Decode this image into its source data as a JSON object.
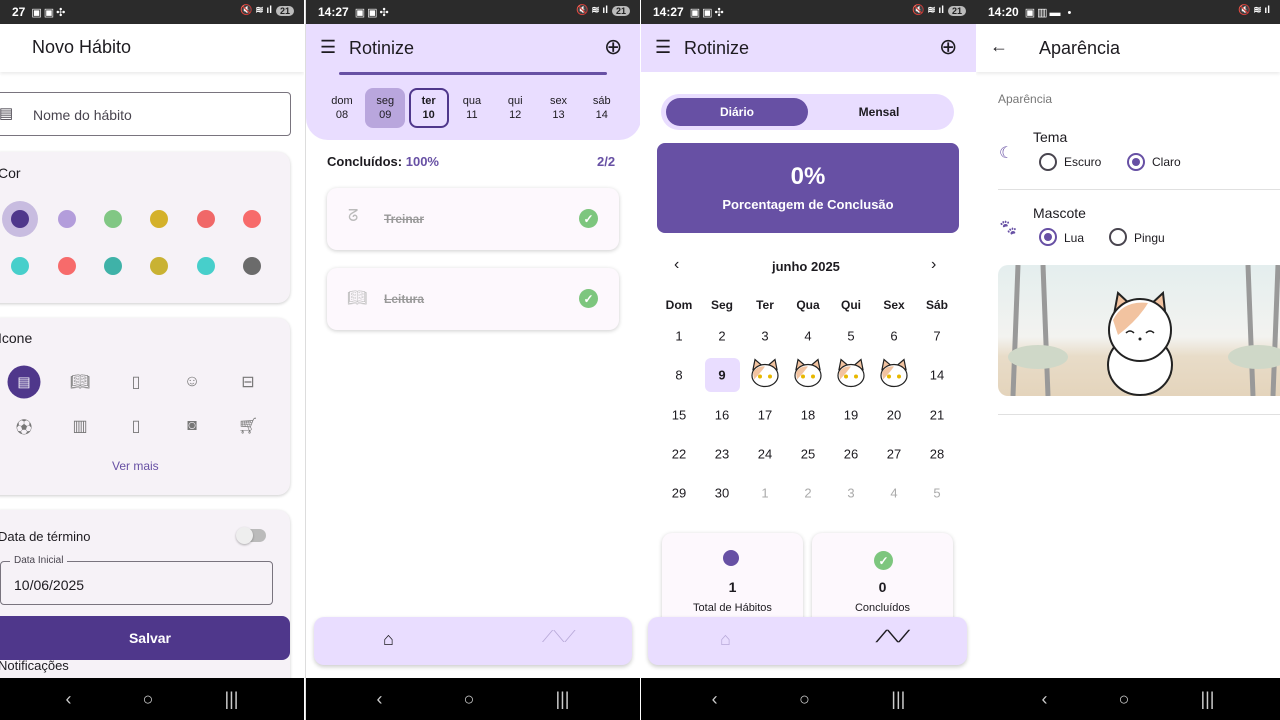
{
  "status": {
    "p1_time": "27",
    "p2_time": "14:27",
    "p3_time": "14:27",
    "p4_time": "14:20",
    "battery": "21"
  },
  "p1": {
    "title": "Novo Hábito",
    "name_placeholder": "Nome do hábito",
    "color_title": "Cor",
    "colors": [
      "#4f378b",
      "#b39ddb",
      "#81c784",
      "#d4b12a",
      "#f06868",
      "#f76b6b",
      "#47cfcb",
      "#f76b6b",
      "#3fb2a8",
      "#c9b233",
      "#47cfcb",
      "#6b6b6b"
    ],
    "icon_title": "Icone",
    "icons": [
      "form",
      "book",
      "notebook",
      "face",
      "briefcase",
      "soccer",
      "luggage",
      "phone",
      "camera",
      "cart"
    ],
    "more": "Ver mais",
    "end_date_label": "Data de término",
    "start_date_label": "Data Inicial",
    "start_date": "10/06/2025",
    "save": "Salvar",
    "notifications": "Notificações"
  },
  "p2": {
    "title": "Rotinize",
    "days": [
      {
        "d": "dom",
        "n": "08"
      },
      {
        "d": "seg",
        "n": "09"
      },
      {
        "d": "ter",
        "n": "10"
      },
      {
        "d": "qua",
        "n": "11"
      },
      {
        "d": "qui",
        "n": "12"
      },
      {
        "d": "sex",
        "n": "13"
      },
      {
        "d": "sáb",
        "n": "14"
      }
    ],
    "done_label": "Concluídos:",
    "done_pct": "100%",
    "done_count": "2/2",
    "habits": [
      {
        "name": "Treinar",
        "icon": "muscle"
      },
      {
        "name": "Leitura",
        "icon": "book"
      }
    ]
  },
  "p3": {
    "title": "Rotinize",
    "tab_daily": "Diário",
    "tab_monthly": "Mensal",
    "pct": "0%",
    "pct_label": "Porcentagem de Conclusão",
    "month": "junho 2025",
    "weekdays": [
      "Dom",
      "Seg",
      "Ter",
      "Qua",
      "Qui",
      "Sex",
      "Sáb"
    ],
    "weeks": [
      [
        "1",
        "2",
        "3",
        "4",
        "5",
        "6",
        "7"
      ],
      [
        "8",
        "9",
        "",
        "",
        "",
        "",
        "14"
      ],
      [
        "15",
        "16",
        "17",
        "18",
        "19",
        "20",
        "21"
      ],
      [
        "22",
        "23",
        "24",
        "25",
        "26",
        "27",
        "28"
      ],
      [
        "29",
        "30",
        "1",
        "2",
        "3",
        "4",
        "5"
      ]
    ],
    "total": "1",
    "total_label": "Total de Hábitos",
    "completed": "0",
    "completed_label": "Concluídos"
  },
  "p4": {
    "title": "Aparência",
    "section": "Aparência",
    "theme": "Tema",
    "dark": "Escuro",
    "light": "Claro",
    "mascot": "Mascote",
    "lua": "Lua",
    "pingu": "Pingu"
  },
  "colors": {
    "primary": "#6750a4",
    "dark_primary": "#4f378b",
    "light_bg": "#e9ddff",
    "success": "#7dc67e"
  }
}
